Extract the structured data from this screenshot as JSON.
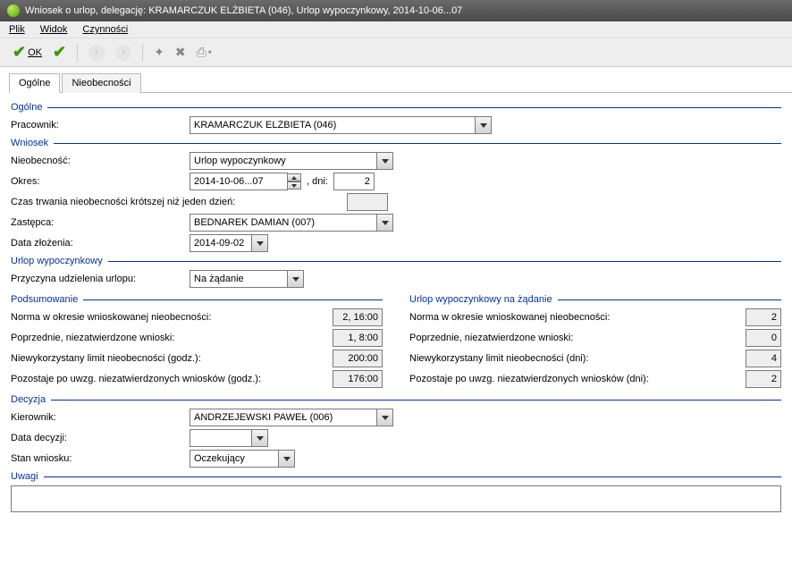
{
  "window": {
    "title": "Wniosek o urlop, delegację: KRAMARCZUK ELŻBIETA (046), Urlop wypoczynkowy, 2014-10-06...07"
  },
  "menu": {
    "plik": "Plik",
    "widok": "Widok",
    "czynnosci": "Czynności"
  },
  "toolbar": {
    "ok": "OK"
  },
  "tabs": {
    "ogolne": "Ogólne",
    "nieobecnosci": "Nieobecności"
  },
  "sections": {
    "ogolne": "Ogólne",
    "wniosek": "Wniosek",
    "urlop_wyp": "Urlop wypoczynkowy",
    "podsumowanie": "Podsumowanie",
    "na_zadanie": "Urlop wypoczynkowy na żądanie",
    "decyzja": "Decyzja",
    "uwagi": "Uwagi"
  },
  "labels": {
    "pracownik": "Pracownik:",
    "nieobecnosc": "Nieobecność:",
    "okres": "Okres:",
    "dni": ", dni:",
    "czas_trwania": "Czas trwania nieobecności krótszej niż jeden dzień:",
    "zastepca": "Zastępca:",
    "data_zlozenia": "Data złożenia:",
    "przyczyna": "Przyczyna udzielenia urlopu:",
    "norma": "Norma w okresie wnioskowanej nieobecności:",
    "poprzednie": "Poprzednie, niezatwierdzone wnioski:",
    "niewykorzystany_godz": "Niewykorzystany limit nieobecności (godz.):",
    "pozostaje_godz": "Pozostaje po uwzg. niezatwierdzonych wniosków (godz.):",
    "niewykorzystany_dni": "Niewykorzystany limit nieobecności (dni):",
    "pozostaje_dni": "Pozostaje po uwzg. niezatwierdzonych wniosków (dni):",
    "kierownik": "Kierownik:",
    "data_decyzji": "Data decyzji:",
    "stan_wniosku": "Stan wniosku:"
  },
  "values": {
    "pracownik": "KRAMARCZUK ELŻBIETA (046)",
    "nieobecnosc": "Urlop wypoczynkowy",
    "okres": "2014-10-06...07",
    "dni": "2",
    "czas_trwania": "",
    "zastepca": "BEDNAREK DAMIAN (007)",
    "data_zlozenia": "2014-09-02",
    "przyczyna": "Na żądanie",
    "kierownik": "ANDRZEJEWSKI PAWEŁ (006)",
    "data_decyzji": "",
    "stan_wniosku": "Oczekujący",
    "uwagi": ""
  },
  "summary_left": {
    "norma": "2, 16:00",
    "poprzednie": "1, 8:00",
    "niewykorzystany": "200:00",
    "pozostaje": "176:00"
  },
  "summary_right": {
    "norma": "2",
    "poprzednie": "0",
    "niewykorzystany": "4",
    "pozostaje": "2"
  }
}
